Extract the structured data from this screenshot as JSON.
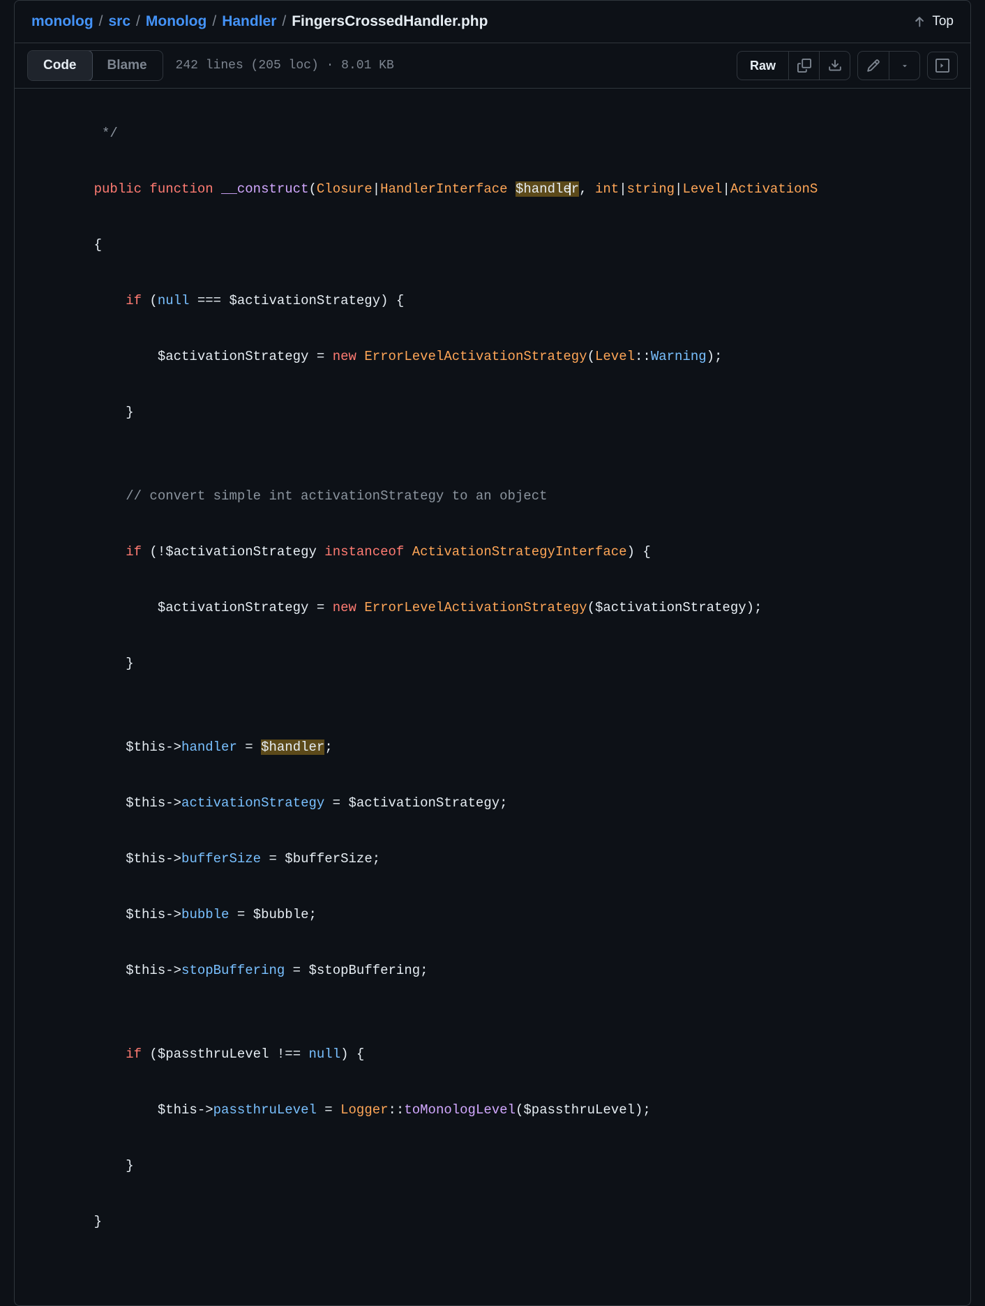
{
  "breadcrumb": {
    "parts": [
      "monolog",
      "src",
      "Monolog",
      "Handler"
    ],
    "current": "FingersCrossedHandler.php"
  },
  "top_button": "Top",
  "tabs": {
    "code": "Code",
    "blame": "Blame"
  },
  "file_info": "242 lines (205 loc) · 8.01 KB",
  "raw_label": "Raw",
  "code": {
    "l1": "     */",
    "l2a": "    public",
    "l2b": " function",
    "l2c": " __construct",
    "l2d": "(",
    "l2e": "Closure",
    "l2f": "|",
    "l2g": "HandlerInterface",
    "l2h": " ",
    "l2i": "$handler",
    "l2j": ", ",
    "l2k": "int",
    "l2l": "|",
    "l2m": "string",
    "l2n": "|",
    "l2o": "Level",
    "l2p": "|",
    "l2q": "ActivationS",
    "l3": "    {",
    "l4a": "        if",
    "l4b": " (",
    "l4c": "null",
    "l4d": " === ",
    "l4e": "$activationStrategy",
    "l4f": ") {",
    "l5a": "            ",
    "l5b": "$activationStrategy",
    "l5c": " = ",
    "l5d": "new",
    "l5e": " ",
    "l5f": "ErrorLevelActivationStrategy",
    "l5g": "(",
    "l5h": "Level",
    "l5i": "::",
    "l5j": "Warning",
    "l5k": ");",
    "l6": "        }",
    "l7": "",
    "l8": "        // convert simple int activationStrategy to an object",
    "l9a": "        if",
    "l9b": " (!",
    "l9c": "$activationStrategy",
    "l9d": " instanceof",
    "l9e": " ",
    "l9f": "ActivationStrategyInterface",
    "l9g": ") {",
    "l10a": "            ",
    "l10b": "$activationStrategy",
    "l10c": " = ",
    "l10d": "new",
    "l10e": " ",
    "l10f": "ErrorLevelActivationStrategy",
    "l10g": "(",
    "l10h": "$activationStrategy",
    "l10i": ");",
    "l11": "        }",
    "l12": "",
    "l13a": "        ",
    "l13b": "$this",
    "l13c": "->",
    "l13d": "handler",
    "l13e": " = ",
    "l13f": "$handler",
    "l13g": ";",
    "l14a": "        ",
    "l14b": "$this",
    "l14c": "->",
    "l14d": "activationStrategy",
    "l14e": " = ",
    "l14f": "$activationStrategy",
    "l14g": ";",
    "l15a": "        ",
    "l15b": "$this",
    "l15c": "->",
    "l15d": "bufferSize",
    "l15e": " = ",
    "l15f": "$bufferSize",
    "l15g": ";",
    "l16a": "        ",
    "l16b": "$this",
    "l16c": "->",
    "l16d": "bubble",
    "l16e": " = ",
    "l16f": "$bubble",
    "l16g": ";",
    "l17a": "        ",
    "l17b": "$this",
    "l17c": "->",
    "l17d": "stopBuffering",
    "l17e": " = ",
    "l17f": "$stopBuffering",
    "l17g": ";",
    "l18": "",
    "l19a": "        if",
    "l19b": " (",
    "l19c": "$passthruLevel",
    "l19d": " !== ",
    "l19e": "null",
    "l19f": ") {",
    "l20a": "            ",
    "l20b": "$this",
    "l20c": "->",
    "l20d": "passthruLevel",
    "l20e": " = ",
    "l20f": "Logger",
    "l20g": "::",
    "l20h": "toMonologLevel",
    "l20i": "(",
    "l20j": "$passthruLevel",
    "l20k": ");",
    "l21": "        }",
    "l22": "    }"
  }
}
